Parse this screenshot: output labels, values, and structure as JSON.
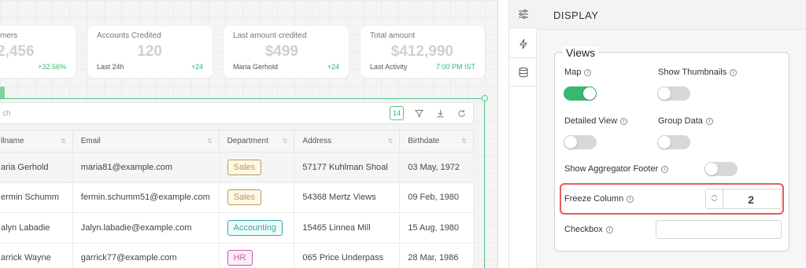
{
  "stats": [
    {
      "title": "mers",
      "value": "2,456",
      "sub": "",
      "delta": "+32.56%"
    },
    {
      "title": "Accounts Credited",
      "value": "120",
      "sub": "Last 24h",
      "delta": "+24"
    },
    {
      "title": "Last amount credited",
      "value": "$499",
      "sub": "Maria Gerhold",
      "delta": "+24"
    },
    {
      "title": "Total amount",
      "value": "$412,990",
      "sub": "Last Activity",
      "delta": "7:00 PM IST"
    }
  ],
  "toolbar": {
    "search_placeholder": "ch",
    "count": "14"
  },
  "table": {
    "headers": [
      "llname",
      "Email",
      "Department",
      "Address",
      "Birthdate"
    ],
    "rows": [
      {
        "name": "aria Gerhold",
        "email": "maria81@example.com",
        "dept": "Sales",
        "address": "57177 Kuhlman Shoal",
        "birth": "03 May, 1972"
      },
      {
        "name": "ermin Schumm",
        "email": "fermin.schumm51@example.com",
        "dept": "Sales",
        "address": "54368 Mertz Views",
        "birth": "09 Feb, 1980"
      },
      {
        "name": "alyn Labadie",
        "email": "Jalyn.labadie@example.com",
        "dept": "Accounting",
        "address": "15465 Linnea Mill",
        "birth": "15 Aug, 1980"
      },
      {
        "name": "arrick Wayne",
        "email": "garrick77@example.com",
        "dept": "HR",
        "address": "065 Price Underpass",
        "birth": "28 Mar, 1986"
      }
    ]
  },
  "dept_colors": {
    "Sales": "#b59a57",
    "Accounting": "#3aa9a1",
    "HR": "#c75aa8"
  },
  "panel": {
    "title": "DISPLAY",
    "views_legend": "Views",
    "map_label": "Map",
    "map_on": true,
    "thumbnails_label": "Show Thumbnails",
    "thumbnails_on": false,
    "detailed_label": "Detailed View",
    "detailed_on": false,
    "group_label": "Group Data",
    "group_on": false,
    "aggregator_label": "Show Aggregator Footer",
    "aggregator_on": false,
    "freeze_label": "Freeze Column",
    "freeze_value": "2",
    "checkbox_label": "Checkbox",
    "checkbox_value": ""
  },
  "icons": [
    "sliders-icon",
    "lightning-icon",
    "database-icon",
    "info-icon",
    "filter-icon",
    "download-icon",
    "refresh-icon",
    "sort-icon",
    "chevron-up-icon",
    "chevron-down-icon"
  ],
  "colors": {
    "accent_green": "#39b86d",
    "highlight_red": "#e25c5c",
    "email_blue": "#3d9ad1"
  }
}
